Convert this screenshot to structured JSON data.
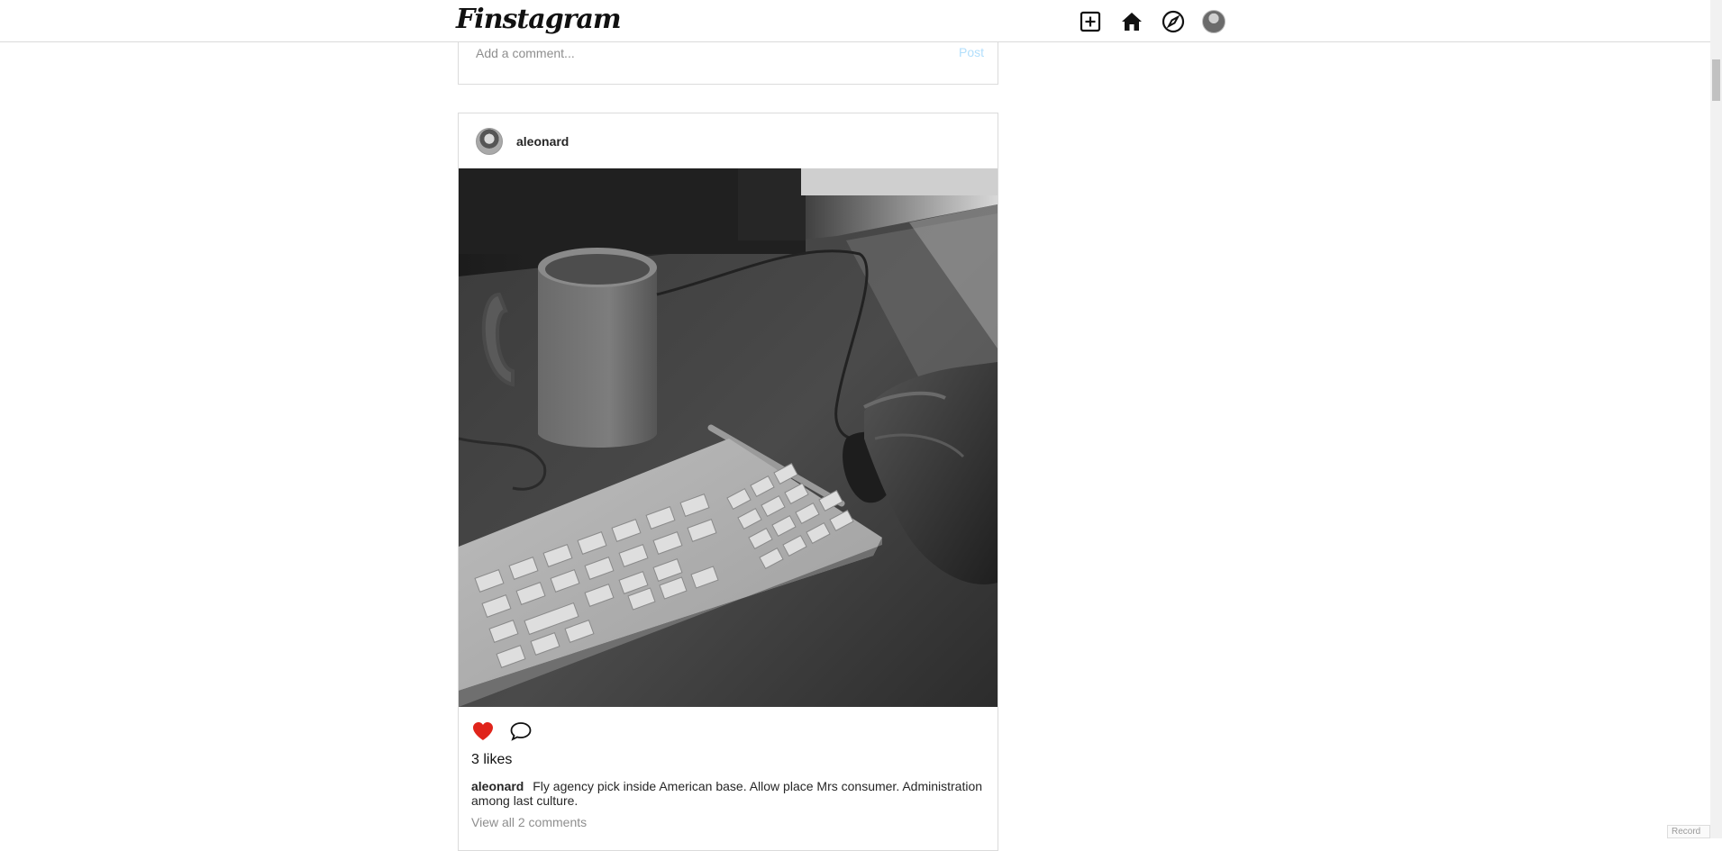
{
  "app": {
    "logo_text": "Finstagram"
  },
  "nav": {
    "icons": [
      "add-post-icon",
      "home-icon",
      "explore-compass-icon",
      "profile-avatar"
    ]
  },
  "comment_box": {
    "placeholder": "Add a comment...",
    "post_label": "Post"
  },
  "post": {
    "username": "aleonard",
    "image_alt": "Black and white photo of a mug, keyboard and a hand on a mouse on a desk",
    "likes_text": "3 likes",
    "liked": true,
    "caption_user": "aleonard",
    "caption_text": "Fly agency pick inside American base. Allow place Mrs consumer. Administration among last culture.",
    "view_all_text": "View all 2 comments"
  },
  "colors": {
    "like_red": "#ed4956",
    "border": "#dbdbdb",
    "post_button_disabled": "#b2dffc"
  },
  "corner_widget": {
    "label": "Record"
  }
}
